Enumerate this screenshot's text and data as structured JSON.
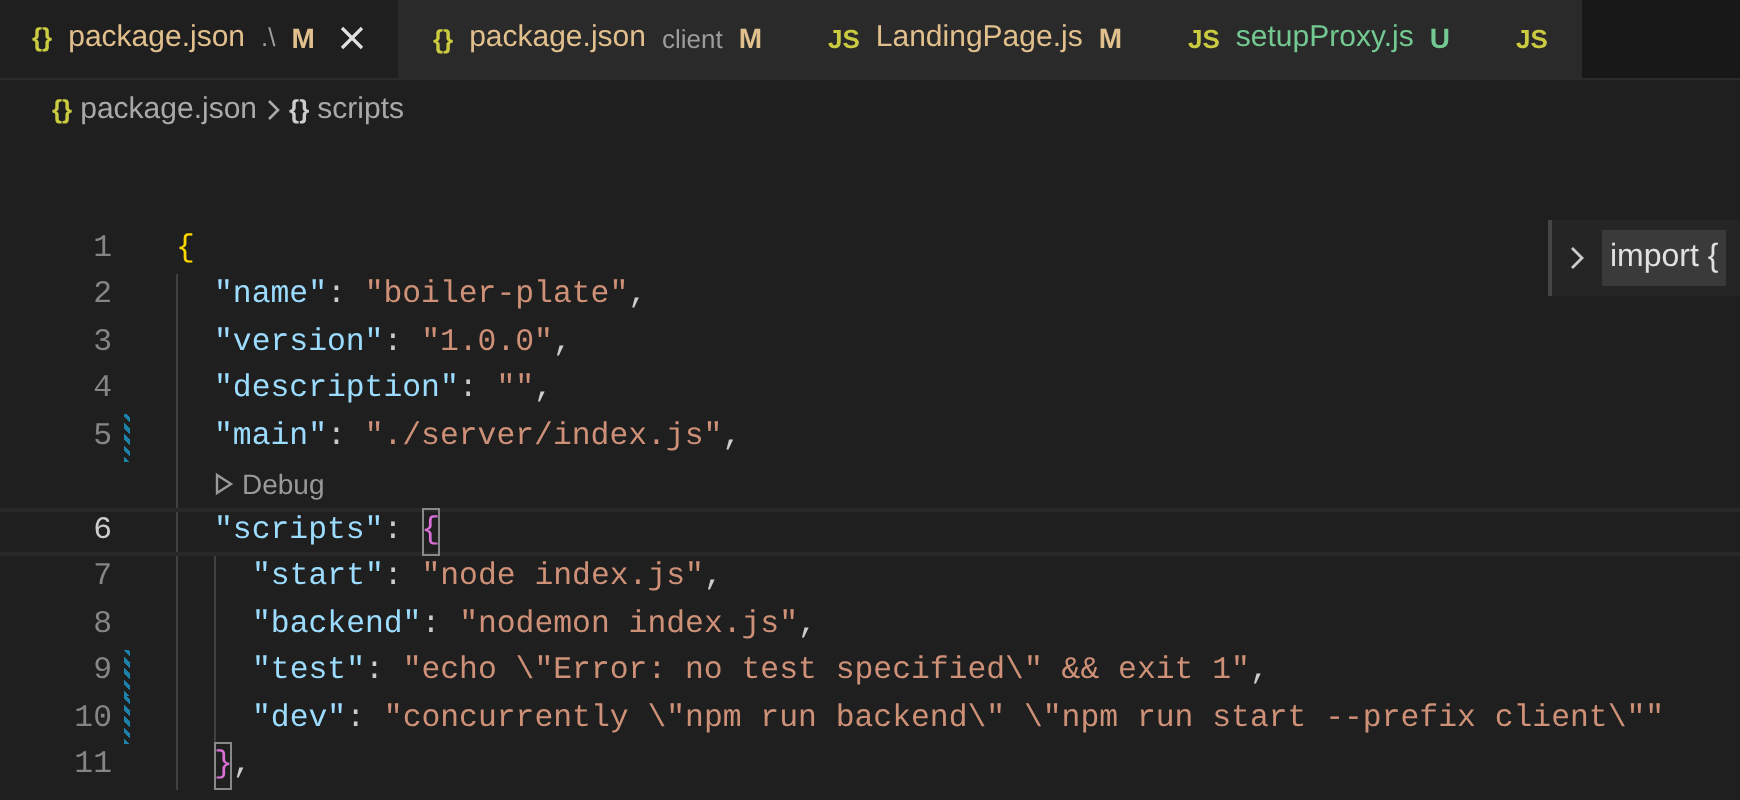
{
  "tabs": [
    {
      "icon": "{}",
      "label": "package.json",
      "description": ".\\",
      "status": "M",
      "kind": "modified",
      "selected": true,
      "closable": true
    },
    {
      "icon": "{}",
      "label": "package.json",
      "description": "client",
      "status": "M",
      "kind": "modified",
      "selected": false,
      "closable": false
    },
    {
      "icon": "JS",
      "label": "LandingPage.js",
      "status": "M",
      "kind": "modified",
      "selected": false,
      "closable": false
    },
    {
      "icon": "JS",
      "label": "setupProxy.js",
      "status": "U",
      "kind": "untracked",
      "selected": false,
      "closable": false
    },
    {
      "icon": "JS",
      "selected": false,
      "closable": false
    }
  ],
  "breadcrumb": [
    {
      "icon": "{}",
      "kind": "file",
      "label": "package.json"
    },
    {
      "icon": "{}",
      "kind": "object",
      "label": "scripts"
    }
  ],
  "peek": {
    "text": "import {"
  },
  "lines": [
    {
      "number": "1",
      "modified": false,
      "current": false,
      "tokens": [
        {
          "kind": "brace1",
          "text": "{"
        }
      ],
      "children": [
        {
          "number": "2",
          "modified": false,
          "current": false,
          "tokens": [
            {
              "kind": "key",
              "text": "\"name\""
            },
            {
              "kind": "punct",
              "text": ": "
            },
            {
              "kind": "string",
              "text": "\"boiler-plate\""
            },
            {
              "kind": "punct",
              "text": ","
            }
          ]
        },
        {
          "number": "3",
          "modified": false,
          "current": false,
          "tokens": [
            {
              "kind": "key",
              "text": "\"version\""
            },
            {
              "kind": "punct",
              "text": ": "
            },
            {
              "kind": "string",
              "text": "\"1.0.0\""
            },
            {
              "kind": "punct",
              "text": ","
            }
          ]
        },
        {
          "number": "4",
          "modified": false,
          "current": false,
          "tokens": [
            {
              "kind": "key",
              "text": "\"description\""
            },
            {
              "kind": "punct",
              "text": ": "
            },
            {
              "kind": "string",
              "text": "\"\""
            },
            {
              "kind": "punct",
              "text": ","
            }
          ]
        },
        {
          "number": "5",
          "modified": true,
          "current": false,
          "tokens": [
            {
              "kind": "key",
              "text": "\"main\""
            },
            {
              "kind": "punct",
              "text": ": "
            },
            {
              "kind": "string",
              "text": "\"./server/index.js\""
            },
            {
              "kind": "punct",
              "text": ","
            }
          ],
          "codelens": "Debug"
        },
        {
          "number": "6",
          "modified": false,
          "current": true,
          "tokens": [
            {
              "kind": "key",
              "text": "\"scripts\""
            },
            {
              "kind": "punct",
              "text": ": "
            },
            {
              "kind": "brace2",
              "text": "{",
              "matched": true
            }
          ],
          "children": [
            {
              "number": "7",
              "modified": false,
              "current": false,
              "tokens": [
                {
                  "kind": "key",
                  "text": "\"start\""
                },
                {
                  "kind": "punct",
                  "text": ": "
                },
                {
                  "kind": "string",
                  "text": "\"node index.js\""
                },
                {
                  "kind": "punct",
                  "text": ","
                }
              ]
            },
            {
              "number": "8",
              "modified": false,
              "current": false,
              "tokens": [
                {
                  "kind": "key",
                  "text": "\"backend\""
                },
                {
                  "kind": "punct",
                  "text": ": "
                },
                {
                  "kind": "string",
                  "text": "\"nodemon index.js\""
                },
                {
                  "kind": "punct",
                  "text": ","
                }
              ]
            },
            {
              "number": "9",
              "modified": true,
              "current": false,
              "tokens": [
                {
                  "kind": "key",
                  "text": "\"test\""
                },
                {
                  "kind": "punct",
                  "text": ": "
                },
                {
                  "kind": "string",
                  "text": "\"echo \\\"Error: no test specified\\\" && exit 1\""
                },
                {
                  "kind": "punct",
                  "text": ","
                }
              ]
            },
            {
              "number": "10",
              "modified": true,
              "current": false,
              "tokens": [
                {
                  "kind": "key",
                  "text": "\"dev\""
                },
                {
                  "kind": "punct",
                  "text": ": "
                },
                {
                  "kind": "string",
                  "text": "\"concurrently \\\"npm run backend\\\" \\\"npm run start --prefix client\\\"\""
                }
              ]
            }
          ]
        },
        {
          "number": "11",
          "modified": false,
          "current": false,
          "tokens": [
            {
              "kind": "brace2",
              "text": "}",
              "matched": true
            },
            {
              "kind": "punct",
              "text": ","
            }
          ]
        }
      ]
    }
  ]
}
